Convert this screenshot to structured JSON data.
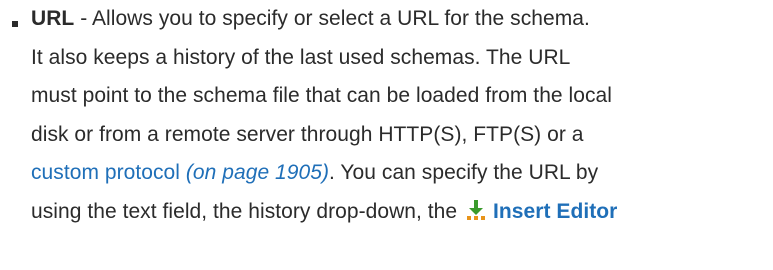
{
  "entry": {
    "term": "URL",
    "line1_rest": " - Allows you to specify or select a URL for the schema.",
    "line2": "It also keeps a history of the last used schemas. The URL",
    "line3": "must point to the schema file that can be loaded from the local",
    "line4": "disk or from a remote server through HTTP(S), FTP(S) or a",
    "link_text": "custom protocol",
    "page_ref": "(on page 1905)",
    "line5_rest": ". You can specify the URL by",
    "line6_start": "using the text field, the history drop-down, the ",
    "ui_label": "Insert Editor",
    "icon_name": "insert-editor-variables-icon",
    "colors": {
      "text": "#2b2b2b",
      "link": "#1f6fb8",
      "icon_green": "#3a9a2c",
      "icon_orange": "#e8941a"
    }
  }
}
